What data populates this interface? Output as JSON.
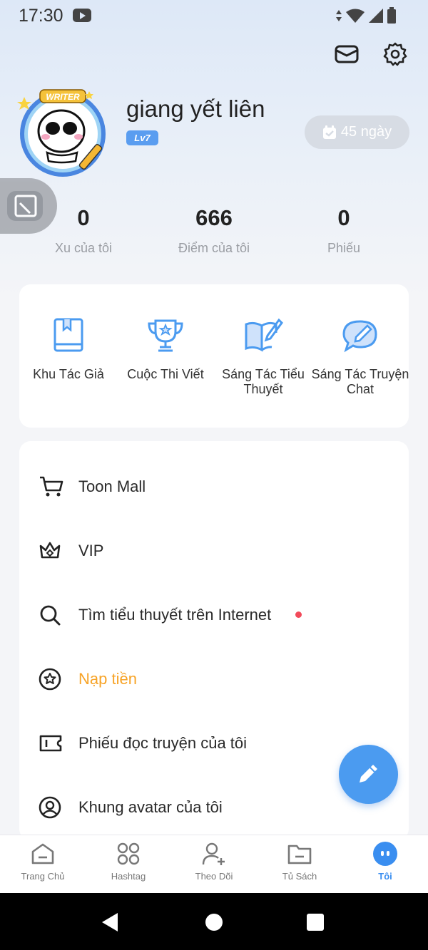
{
  "status_bar": {
    "time": "17:30"
  },
  "profile": {
    "username": "giang yết liên",
    "level": "Lv7",
    "avatar_badge": "WRITER",
    "checkin_label": "45 ngày"
  },
  "stats": [
    {
      "value": "0",
      "label": "Xu của tôi"
    },
    {
      "value": "666",
      "label": "Điểm của tôi"
    },
    {
      "value": "0",
      "label": "Phiếu"
    }
  ],
  "tools": [
    {
      "label": "Khu Tác Giả",
      "icon": "book-icon"
    },
    {
      "label": "Cuộc Thi Viết",
      "icon": "trophy-icon"
    },
    {
      "label": "Sáng Tác Tiểu Thuyết",
      "icon": "open-book-pen-icon"
    },
    {
      "label": "Sáng Tác Truyện Chat",
      "icon": "chat-pen-icon"
    }
  ],
  "menu": [
    {
      "label": "Toon Mall",
      "icon": "cart-icon"
    },
    {
      "label": "VIP",
      "icon": "crown-icon"
    },
    {
      "label": "Tìm tiểu thuyết trên Internet",
      "icon": "search-icon",
      "has_dot": true
    },
    {
      "label": "Nạp tiền",
      "icon": "coin-star-icon",
      "accent": "#f7a326"
    },
    {
      "label": "Phiếu đọc truyện của tôi",
      "icon": "ticket-icon"
    },
    {
      "label": "Khung avatar của tôi",
      "icon": "avatar-frame-icon"
    }
  ],
  "nav": [
    {
      "label": "Trang Chủ",
      "icon": "home-icon"
    },
    {
      "label": "Hashtag",
      "icon": "grid-icon"
    },
    {
      "label": "Theo Dõi",
      "icon": "follow-user-icon"
    },
    {
      "label": "Tủ Sách",
      "icon": "folder-icon"
    },
    {
      "label": "Tôi",
      "icon": "me-icon",
      "active": true
    }
  ],
  "colors": {
    "accent": "#3a8ef0",
    "orange": "#f7a326",
    "badge": "#5a9df0"
  }
}
